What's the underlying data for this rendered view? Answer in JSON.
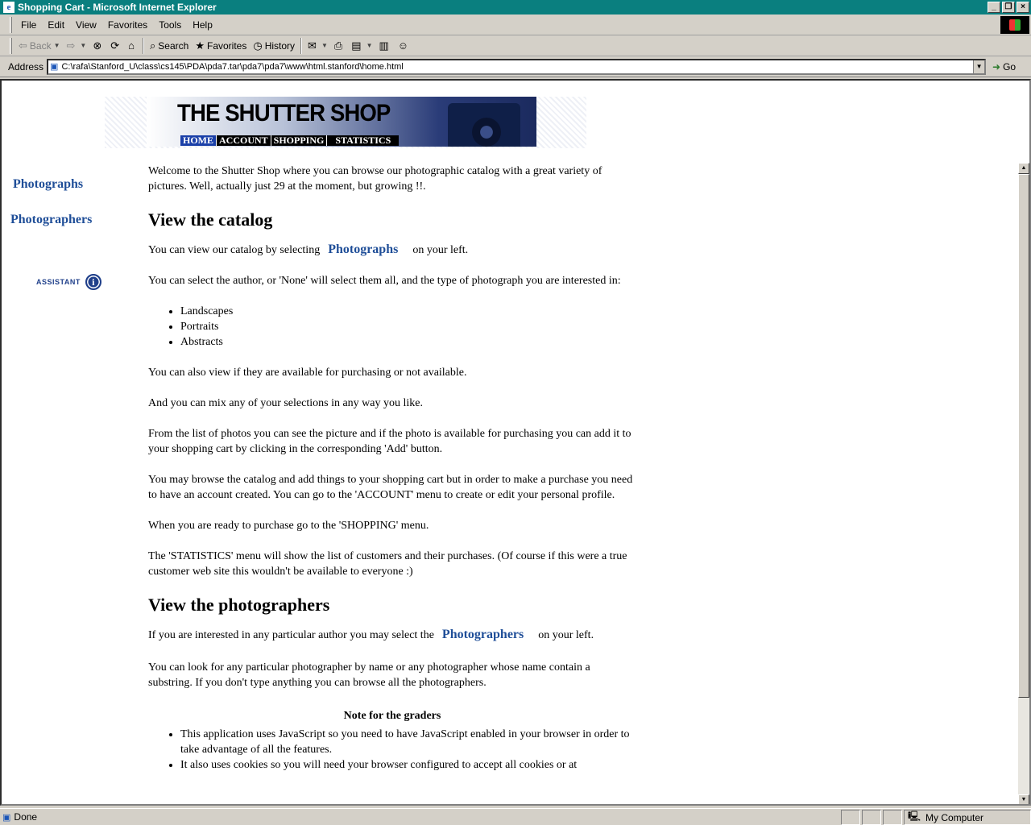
{
  "window": {
    "title": "Shopping Cart - Microsoft Internet Explorer",
    "controls": [
      "_",
      "❐",
      "×"
    ]
  },
  "menu": [
    "File",
    "Edit",
    "View",
    "Favorites",
    "Tools",
    "Help"
  ],
  "toolbar": {
    "back": "Back",
    "search": "Search",
    "favorites": "Favorites",
    "history": "History"
  },
  "address": {
    "label": "Address",
    "url": "C:\\rafa\\Stanford_U\\class\\cs145\\PDA\\pda7.tar\\pda7\\pda7\\www\\html.stanford\\home.html",
    "go": "Go"
  },
  "banner": {
    "title": "THE SHUTTER SHOP",
    "nav": [
      "HOME",
      "ACCOUNT",
      "SHOPPING",
      "STATISTICS"
    ]
  },
  "leftnav": {
    "photographs": "Photographs",
    "photographers": "Photographers",
    "assistant": "ASSISTANT",
    "info_glyph": "i"
  },
  "content": {
    "intro": "Welcome to the Shutter Shop where you can browse our photographic catalog with a great variety of pictures. Well, actually just 29 at the moment, but growing !!.",
    "h_catalog": "View the catalog",
    "catalog_before": "You can view our catalog by selecting",
    "catalog_link": "Photographs",
    "catalog_after": "on your left.",
    "select_author": "You can select the author, or 'None' will select them all, and the type of photograph you are interested in:",
    "types": [
      "Landscapes",
      "Portraits",
      "Abstracts"
    ],
    "available": "You can also view if they are available for purchasing or not available.",
    "mix": "And you can mix any of your selections in any way you like.",
    "list": "From the list of photos you can see the picture and if the photo is available for purchasing you can add it to your shopping cart by clicking in the corresponding 'Add' button.",
    "account": "You may browse the catalog and add things to your shopping cart but in order to make a purchase you need to have an account created.  You can go to the 'ACCOUNT' menu to create or edit your personal profile.",
    "shopping": "When you are ready to purchase go to the 'SHOPPING' menu.",
    "statistics": "The 'STATISTICS' menu will show the list of customers and their purchases. (Of course if this were a true customer web site this wouldn't be available to everyone :)",
    "h_photographers": "View the photographers",
    "photographers_before": "If you are interested in any particular author you may select the",
    "photographers_link": "Photographers",
    "photographers_after": "on your left.",
    "lookup": "You can look for any particular photographer by name or any photographer whose name contain a substring. If you don't type anything you can browse all the photographers.",
    "note_title": "Note for the graders",
    "notes": [
      "This application uses JavaScript so you need to have JavaScript enabled in your browser in order to take advantage of all the features.",
      "It also uses cookies so you will need your browser configured to accept all cookies or at"
    ]
  },
  "status": {
    "text": "Done",
    "zone": "My Computer"
  }
}
